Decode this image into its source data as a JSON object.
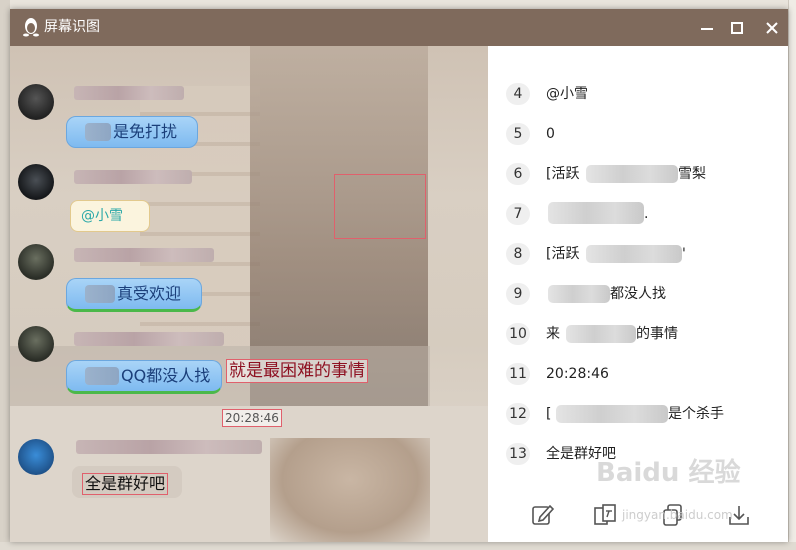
{
  "window": {
    "title": "屏幕识图",
    "controls": [
      "minimize",
      "maximize",
      "close"
    ]
  },
  "screenshot": {
    "bubbles": [
      {
        "text": "是免打扰"
      },
      {
        "text": "@小雪"
      },
      {
        "text": "真受欢迎"
      },
      {
        "text": "QQ都没人找"
      }
    ],
    "ocr_overlay": [
      "就是最困难的事情",
      "20:28:46",
      "全是群好吧"
    ]
  },
  "results": [
    {
      "index": "4",
      "text": "@小雪"
    },
    {
      "index": "5",
      "text": "0"
    },
    {
      "index": "6",
      "text_start": "[活跃",
      "text_end": "雪梨"
    },
    {
      "index": "7",
      "text_start": "",
      "text_end": "."
    },
    {
      "index": "8",
      "text_start": "[活跃",
      "text_end": "'"
    },
    {
      "index": "9",
      "text_start": "",
      "text_end": "都没人找"
    },
    {
      "index": "10",
      "text_start": "来",
      "text_end": "的事情"
    },
    {
      "index": "11",
      "text": "20:28:46"
    },
    {
      "index": "12",
      "text_start": "[",
      "text_end": "是个杀手"
    },
    {
      "index": "13",
      "text": "全是群好吧"
    }
  ],
  "toolbar": [
    "edit-icon",
    "translate-icon",
    "copy-icon",
    "download-icon"
  ],
  "watermark": {
    "main": "Baidu 经验",
    "sub": "jingyan.baidu.com"
  },
  "colors": {
    "titlebar": "#7f6a5c",
    "ocr_border": "#e0606c",
    "bubble_blue": "#7ebaf0"
  }
}
